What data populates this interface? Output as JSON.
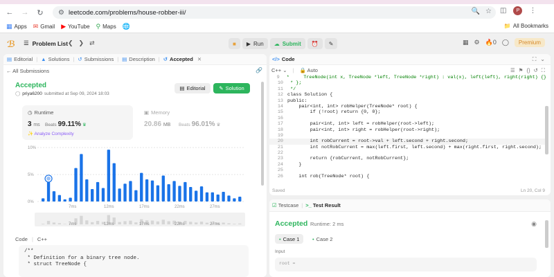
{
  "browser": {
    "url": "leetcode.com/problems/house-robber-iii/",
    "profile_initial": "P",
    "bookmarks": [
      "Apps",
      "Gmail",
      "YouTube",
      "Maps"
    ],
    "all_bookmarks": "All Bookmarks"
  },
  "topbar": {
    "problem_list": "Problem List",
    "run": "Run",
    "submit": "Submit",
    "fire_count": "0",
    "premium": "Premium"
  },
  "left": {
    "tabs": [
      "Editorial",
      "Solutions",
      "Submissions",
      "Description",
      "Accepted"
    ],
    "all_submissions": "All Submissions",
    "status": "Accepted",
    "user": "priya6200",
    "submitted_at": "submitted at Sep 09, 2024 18:03",
    "editorial_btn": "Editorial",
    "solution_btn": "Solution",
    "runtime_label": "Runtime",
    "runtime_value": "3",
    "runtime_unit": "ms",
    "beats_label": "Beats",
    "runtime_beats": "99.11%",
    "analyze": "Analyze Complexity",
    "memory_label": "Memory",
    "memory_value": "20.86",
    "memory_unit": "MB",
    "memory_beats": "96.01%",
    "code_label": "Code",
    "code_lang": "C++",
    "code_snippet": "/**\n * Definition for a binary tree node.\n * struct TreeNode {"
  },
  "chart_data": {
    "type": "bar",
    "y_ticks": [
      "10%",
      "5%",
      "0%"
    ],
    "x_ticks": [
      "7ms",
      "12ms",
      "17ms",
      "22ms",
      "27ms"
    ],
    "ylim": [
      0,
      10
    ],
    "values": [
      0.6,
      3.6,
      1.9,
      1.2,
      0.4,
      0.7,
      6.2,
      8.8,
      4.1,
      2.3,
      3.6,
      2.5,
      9.6,
      7.1,
      2.4,
      3.3,
      3.8,
      2.1,
      5.3,
      4.1,
      3.9,
      3.0,
      4.8,
      3.2,
      3.8,
      2.9,
      3.6,
      2.7,
      2.0,
      2.8,
      1.7,
      1.7,
      1.3,
      1.8,
      1.1,
      0.6,
      0.9
    ],
    "highlight_index": 1
  },
  "code": {
    "title": "Code",
    "lang": "C++",
    "mode": "Auto",
    "saved": "Saved",
    "cursor": "Ln 20, Col 9",
    "lines": [
      {
        "n": "9",
        "t": " *     TreeNode(int x, TreeNode *left, TreeNode *right) : val(x), left(left), right(right) {}"
      },
      {
        "n": "10",
        "t": " * };"
      },
      {
        "n": "11",
        "t": " */"
      },
      {
        "n": "12",
        "t": "class Solution {"
      },
      {
        "n": "13",
        "t": "public:"
      },
      {
        "n": "14",
        "t": "    pair<int, int> robHelper(TreeNode* root) {"
      },
      {
        "n": "15",
        "t": "        if (!root) return {0, 0};"
      },
      {
        "n": "16",
        "t": ""
      },
      {
        "n": "17",
        "t": "        pair<int, int> left = robHelper(root->left);"
      },
      {
        "n": "18",
        "t": "        pair<int, int> right = robHelper(root->right);"
      },
      {
        "n": "19",
        "t": ""
      },
      {
        "n": "20",
        "t": "        int robCurrent = root->val + left.second + right.second;"
      },
      {
        "n": "21",
        "t": "        int notRobCurrent = max(left.first, left.second) + max(right.first, right.second);"
      },
      {
        "n": "22",
        "t": ""
      },
      {
        "n": "23",
        "t": "        return {robCurrent, notRobCurrent};"
      },
      {
        "n": "24",
        "t": "    }"
      },
      {
        "n": "25",
        "t": ""
      },
      {
        "n": "26",
        "t": "    int rob(TreeNode* root) {"
      }
    ]
  },
  "result": {
    "testcase_tab": "Testcase",
    "result_tab": "Test Result",
    "status": "Accepted",
    "runtime": "Runtime: 2 ms",
    "case1": "Case 1",
    "case2": "Case 2",
    "input_label": "Input",
    "input_value": "root ="
  },
  "colors": {
    "accent_green": "#2db55d",
    "bar_blue": "#1a73e8",
    "link_blue": "#3d8ff0"
  }
}
